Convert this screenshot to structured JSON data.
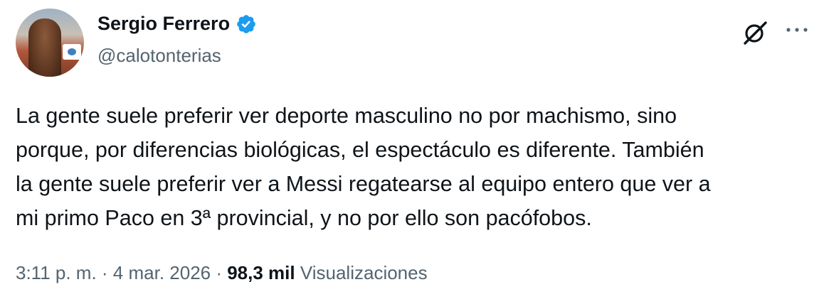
{
  "author": {
    "display_name": "Sergio Ferrero",
    "handle": "@calotonterias",
    "verified": true
  },
  "tweet": {
    "text": "La gente suele preferir ver deporte masculino no por machismo, sino\nporque, por diferencias biológicas, el espectáculo es diferente. También\nla gente suele preferir ver a Messi regatearse al equipo entero que ver a\nmi primo Paco en 3ª provincial, y no por ello son pacófobos."
  },
  "meta": {
    "time": "3:11 p. m.",
    "separator": " · ",
    "date": "4 mar. 2026",
    "views_count": "98,3 mil",
    "views_label": "Visualizaciones"
  },
  "icons": {
    "verified": "verified-badge-icon",
    "grok": "grok-icon",
    "more": "more-options-icon"
  },
  "colors": {
    "text_primary": "#0f1419",
    "text_secondary": "#536471",
    "verified_blue": "#1d9bf0",
    "background": "#ffffff"
  }
}
